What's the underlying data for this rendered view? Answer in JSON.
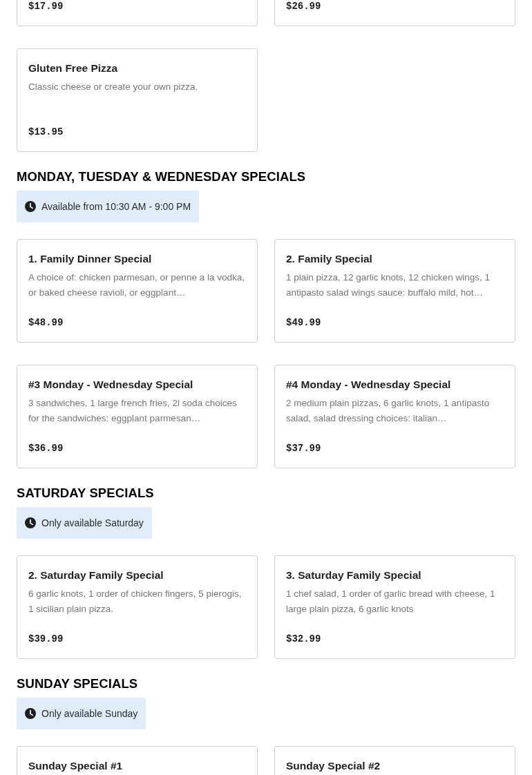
{
  "sections": [
    {
      "cards": [
        {
          "price": "$17.99"
        },
        {
          "price": "$26.99"
        },
        {
          "title": "Gluten Free Pizza",
          "description": "Classic cheese or create your own pizza.",
          "price": "$13.95"
        }
      ]
    },
    {
      "heading": "MONDAY, TUESDAY & WEDNESDAY SPECIALS",
      "availability": "Available from 10:30 AM - 9:00 PM",
      "cards": [
        {
          "title": "1. Family Dinner Special",
          "description": "A choice of: chicken parmesan, or penne a la vodka, or baked cheese ravioli, or eggplant…",
          "price": "$48.99"
        },
        {
          "title": "2. Family Special",
          "description": "1 plain pizza, 12 garlic knots, 12 chicken wings, 1 antipasto salad wings sauce: buffalo mild, hot…",
          "price": "$49.99"
        },
        {
          "title": "#3 Monday - Wednesday Special",
          "description": "3 sandwiches, 1 large french fries, 2l soda choices for the sandwiches: eggplant parmesan…",
          "price": "$36.99"
        },
        {
          "title": "#4 Monday - Wednesday Special",
          "description": "2 medium plain pizzas, 6 garlic knots, 1 antipasto salad, salad dressing choices: italian…",
          "price": "$37.99"
        }
      ]
    },
    {
      "heading": "SATURDAY SPECIALS",
      "availability": "Only available Saturday",
      "cards": [
        {
          "title": "2. Saturday Family Special",
          "description": "6 garlic knots, 1 order of chicken fingers, 5 pierogis, 1 sicilian plain pizza.",
          "price": "$39.99"
        },
        {
          "title": "3. Saturday Family Special",
          "description": "1 chef salad, 1 order of garlic bread with cheese, 1 large plain pizza, 6 garlic knots",
          "price": "$32.99"
        }
      ]
    },
    {
      "heading": "SUNDAY SPECIALS",
      "availability": "Only available Sunday",
      "cards": [
        {
          "title": "Sunday Special #1"
        },
        {
          "title": "Sunday Special #2"
        }
      ]
    }
  ]
}
